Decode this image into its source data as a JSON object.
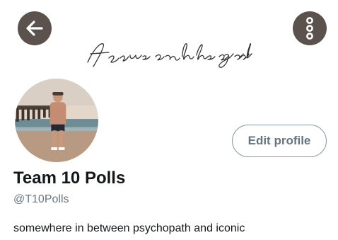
{
  "banner": {
    "script_text": "focus on the good"
  },
  "header": {
    "back_icon": "arrow-left-icon",
    "menu_icon": "more-vertical-icon"
  },
  "profile": {
    "display_name": "Team 10 Polls",
    "handle": "@T10Polls",
    "bio": "somewhere in between psychopath and iconic",
    "edit_label": "Edit profile"
  },
  "colors": {
    "button_bg": "#5b514d",
    "edit_border": "#8a9aa6",
    "handle_text": "#657786"
  }
}
